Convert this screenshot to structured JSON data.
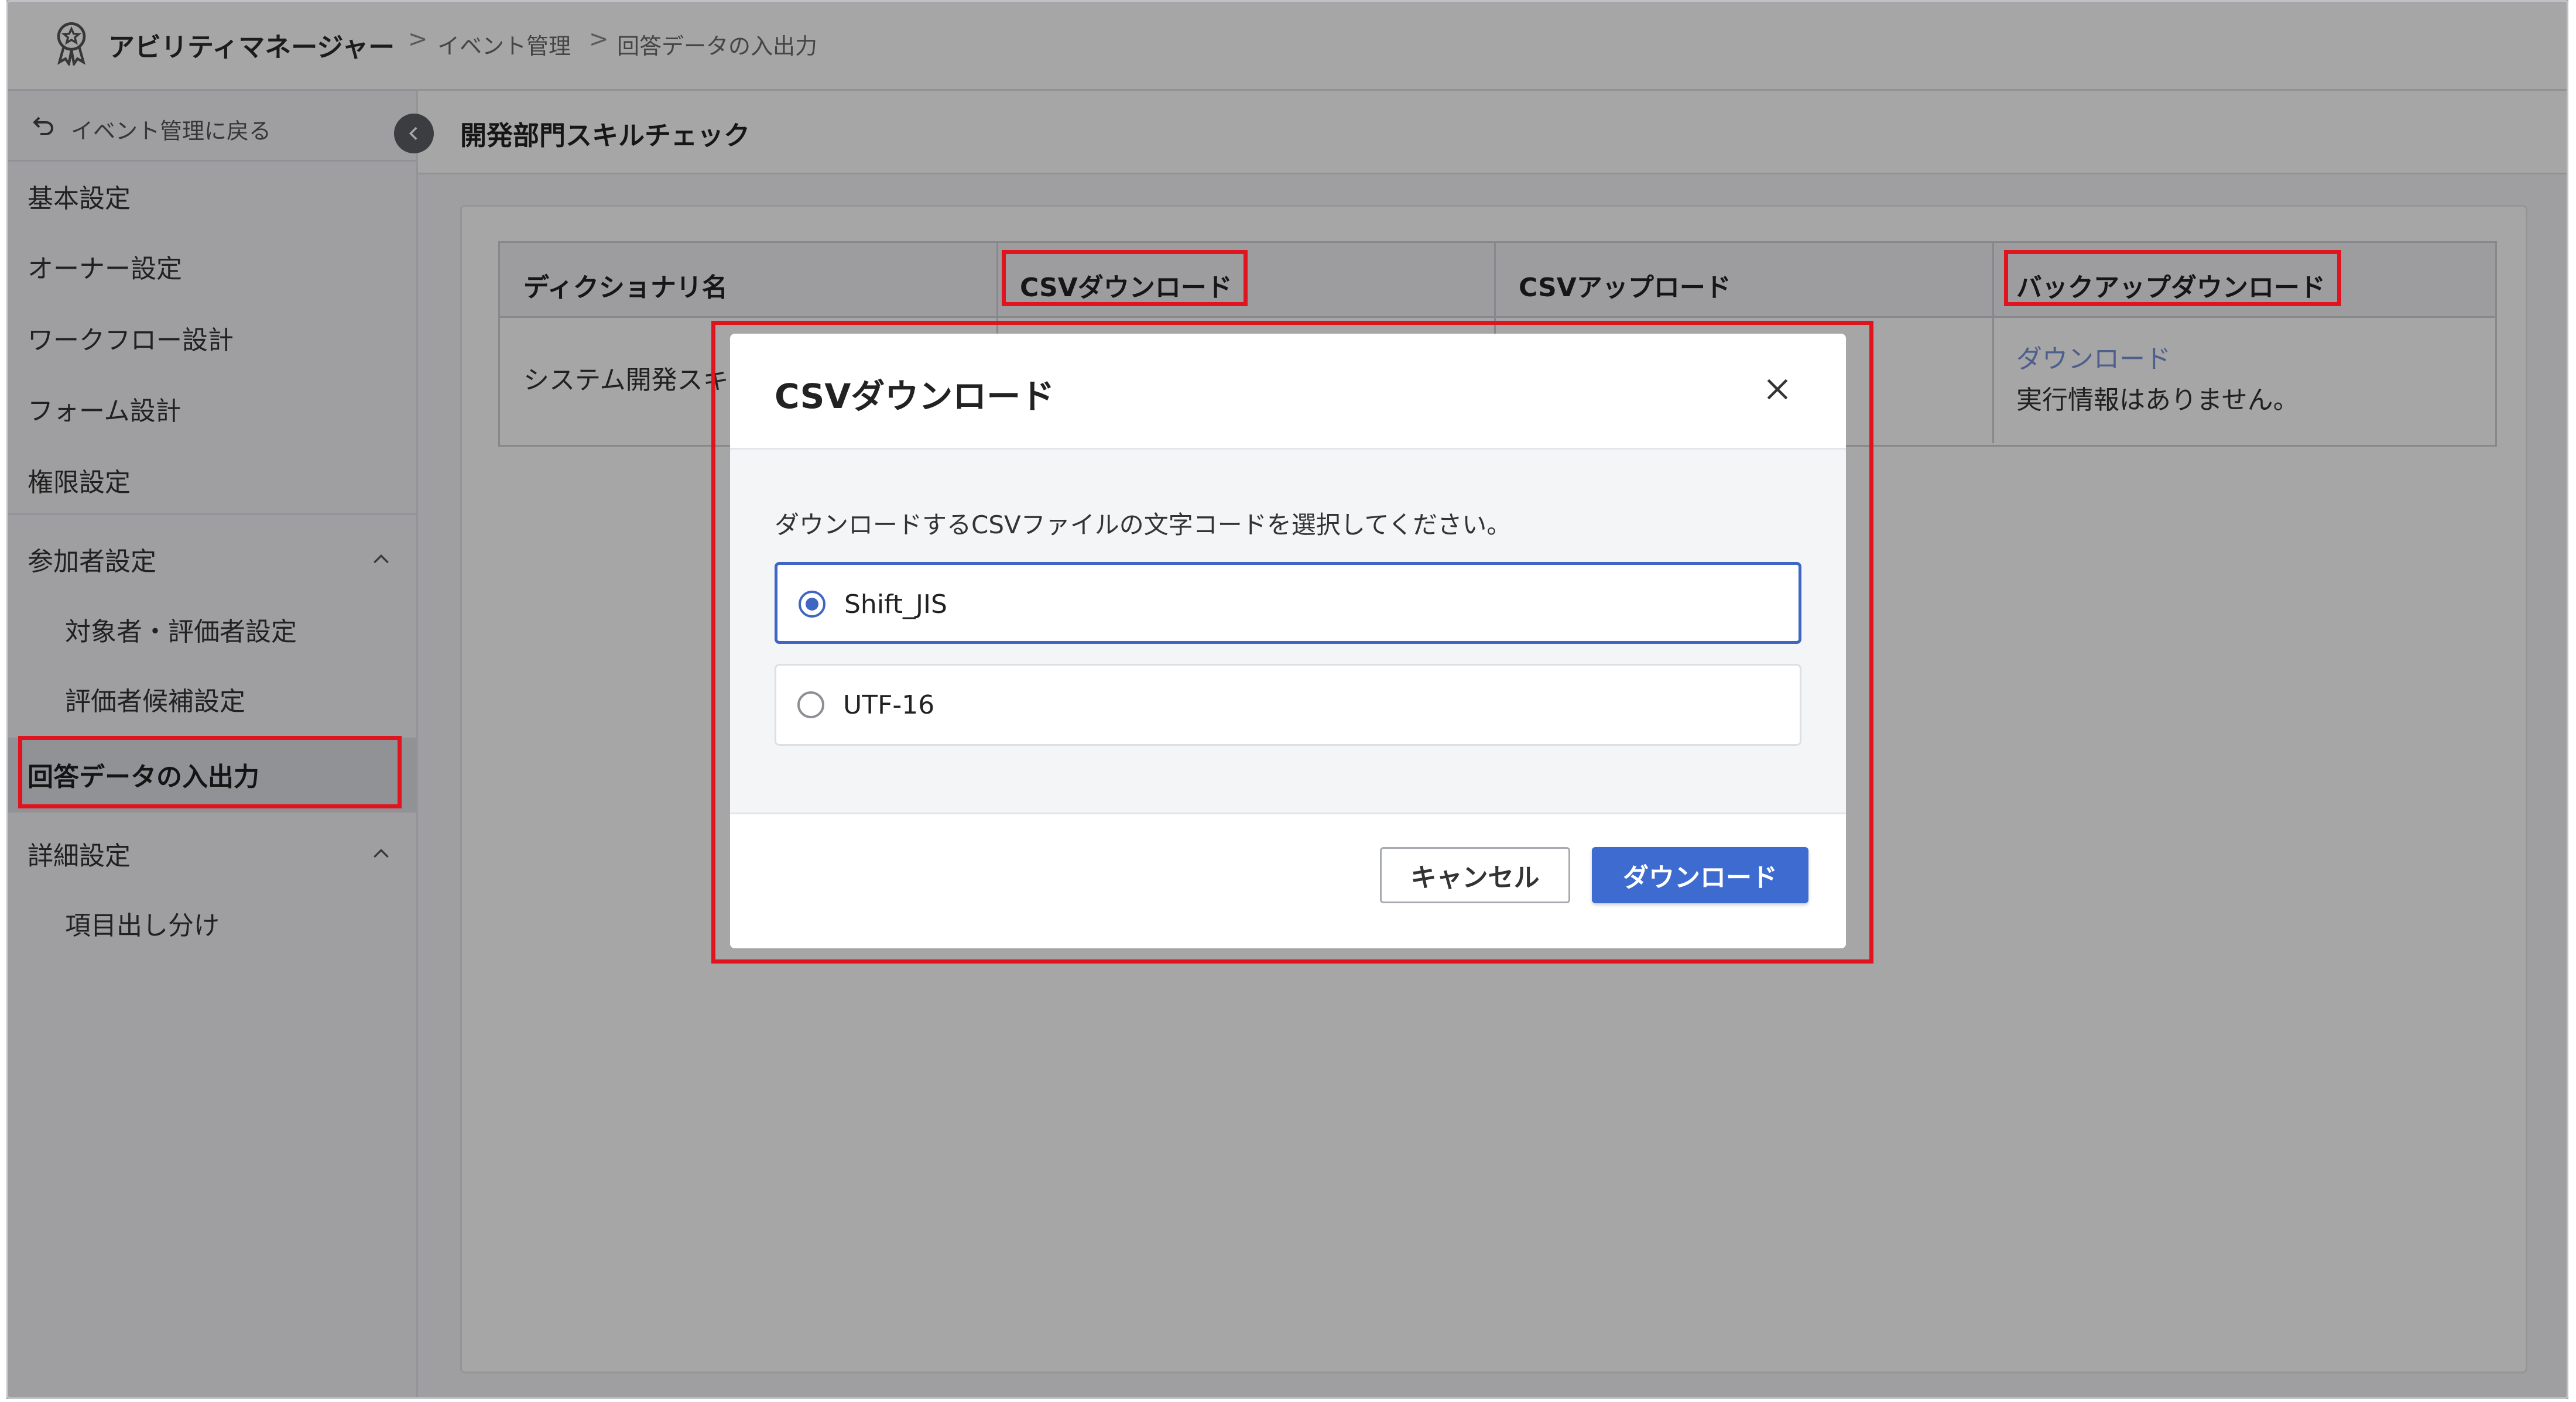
{
  "header": {
    "app_title": "アビリティマネージャー",
    "breadcrumb": [
      "イベント管理",
      "回答データの入出力"
    ],
    "separator": ">"
  },
  "sidebar": {
    "back_label": "イベント管理に戻る",
    "items": [
      {
        "label": "基本設定"
      },
      {
        "label": "オーナー設定"
      },
      {
        "label": "ワークフロー設計"
      },
      {
        "label": "フォーム設計"
      },
      {
        "label": "権限設定"
      }
    ],
    "group_participants": {
      "label": "参加者設定",
      "children": [
        "対象者・評価者設定",
        "評価者候補設定"
      ]
    },
    "active_item": "回答データの入出力",
    "group_details": {
      "label": "詳細設定",
      "children": [
        "項目出し分け"
      ]
    }
  },
  "main": {
    "page_title": "開発部門スキルチェック",
    "table": {
      "headers": [
        "ディクショナリ名",
        "CSVダウンロード",
        "CSVアップロード",
        "バックアップダウンロード"
      ],
      "rows": [
        {
          "name": "システム開発スキ",
          "backup_link": "ダウンロード",
          "backup_status": "実行情報はありません。"
        }
      ]
    }
  },
  "modal": {
    "title": "CSVダウンロード",
    "description": "ダウンロードするCSVファイルの文字コードを選択してください。",
    "options": [
      {
        "label": "Shift_JIS",
        "selected": true
      },
      {
        "label": "UTF-16",
        "selected": false
      }
    ],
    "cancel_label": "キャンセル",
    "confirm_label": "ダウンロード"
  },
  "colors": {
    "primary": "#3e6bd0",
    "highlight": "#e0141e",
    "link": "#7a92d6"
  }
}
